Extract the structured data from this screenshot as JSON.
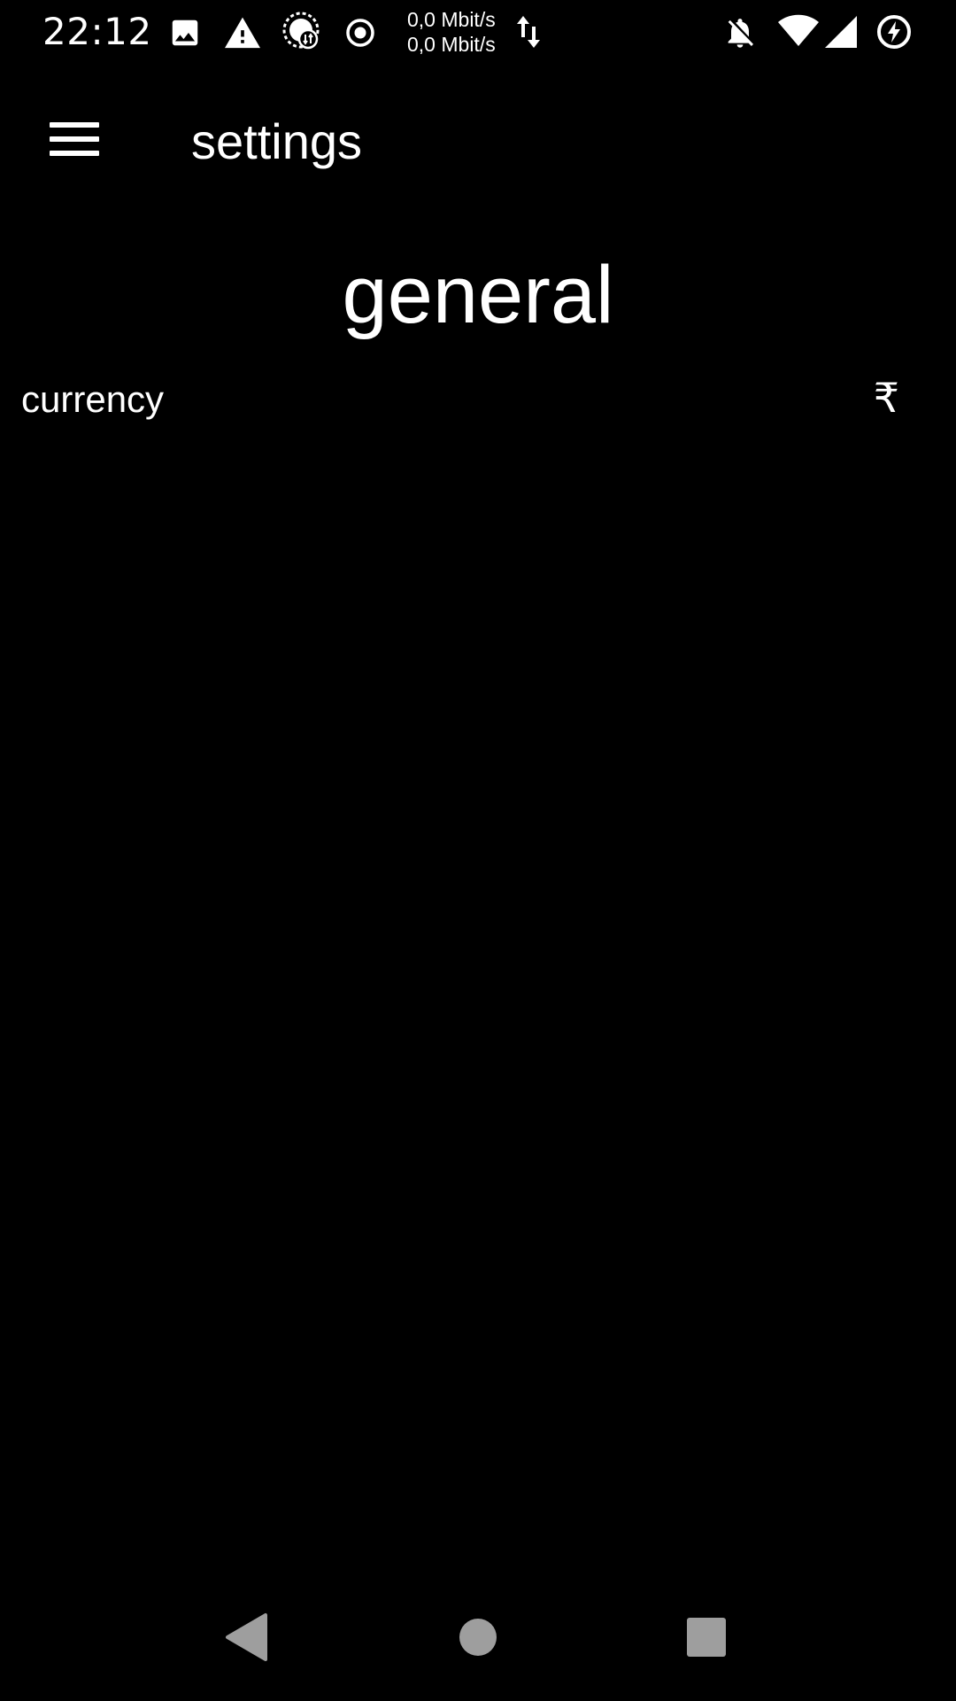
{
  "status_bar": {
    "time": "22:12",
    "net_up": "0,0 Mbit/s",
    "net_down": "0,0 Mbit/s",
    "icons": [
      "image-icon",
      "warning-icon",
      "data-saver-icon",
      "record-icon",
      "data-transfer-icon",
      "notifications-off-icon",
      "wifi-icon",
      "cell-signal-icon",
      "battery-saver-icon"
    ]
  },
  "toolbar": {
    "title": "settings",
    "menu_icon": "hamburger-menu-icon"
  },
  "section": {
    "title": "general"
  },
  "settings": [
    {
      "label": "currency",
      "value": "₹"
    }
  ],
  "nav_bar": {
    "icons": [
      "back-icon",
      "home-icon",
      "recents-icon"
    ],
    "color": "#9e9e9e"
  },
  "colors": {
    "background": "#000000",
    "text": "#ffffff"
  }
}
